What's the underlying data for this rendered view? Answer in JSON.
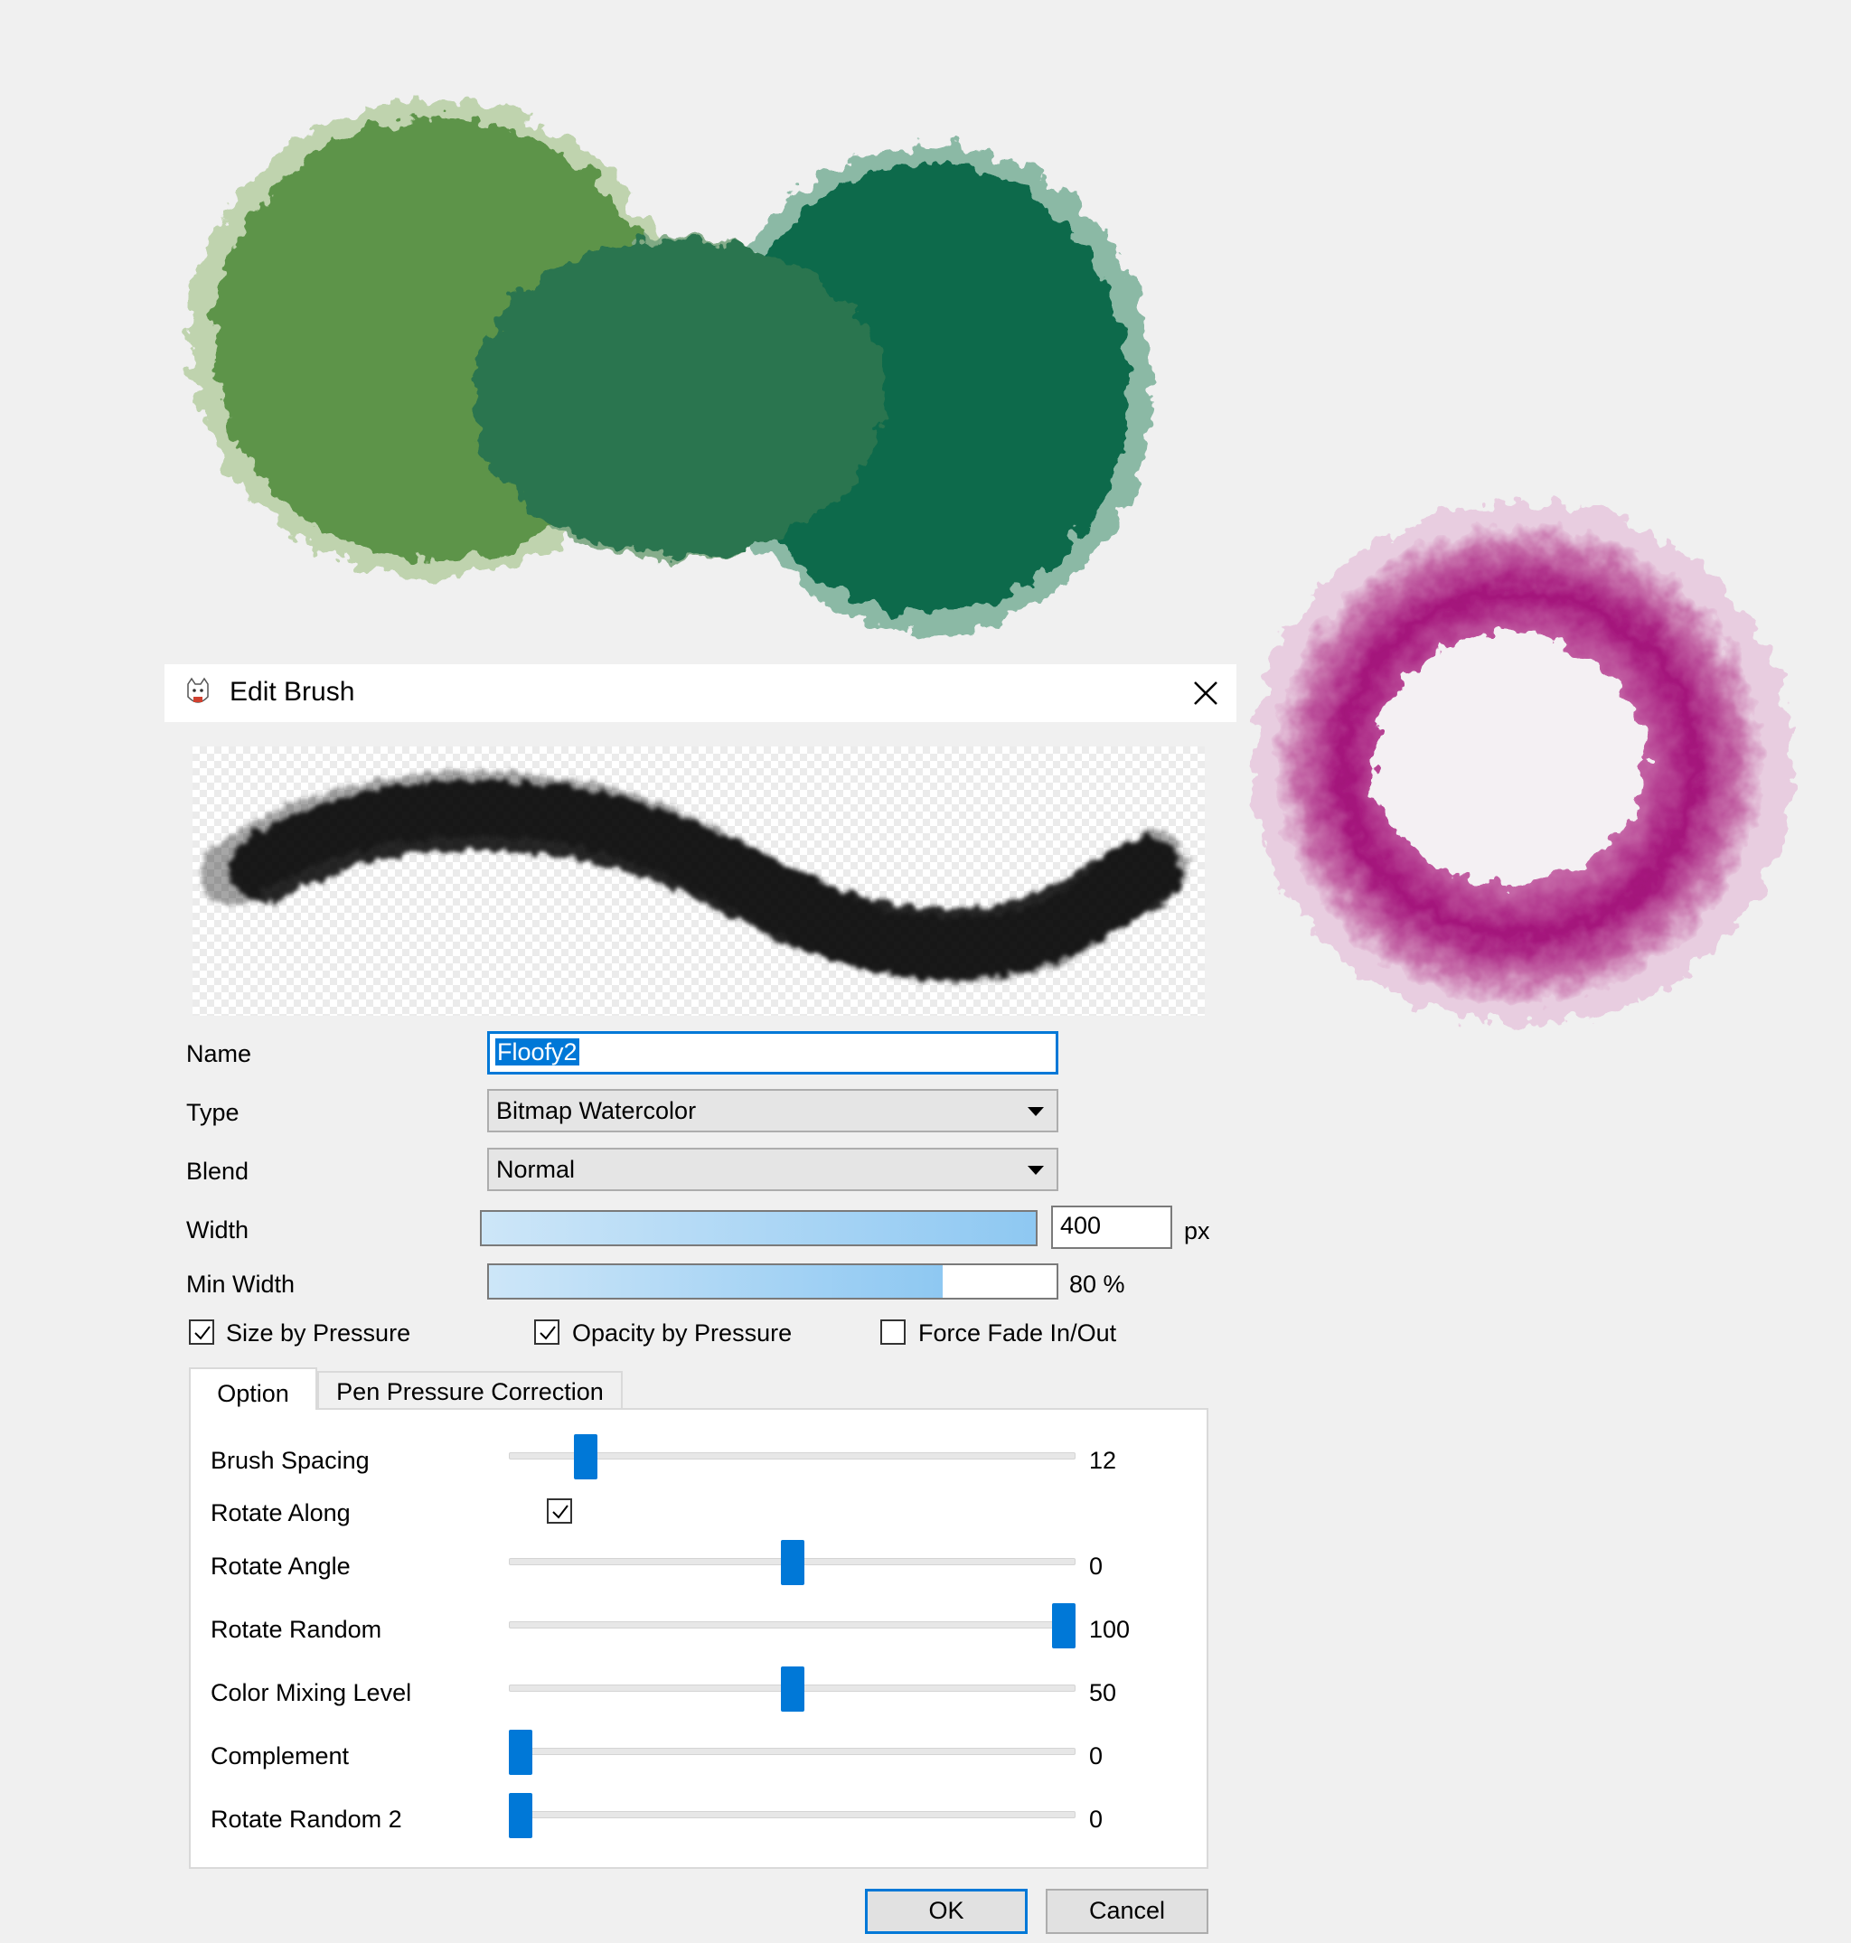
{
  "dialog": {
    "title": "Edit Brush",
    "close_icon": "close-icon",
    "app_icon": "app-icon"
  },
  "form": {
    "name_label": "Name",
    "name_value": "Floofy2",
    "type_label": "Type",
    "type_value": "Bitmap Watercolor",
    "blend_label": "Blend",
    "blend_value": "Normal",
    "width_label": "Width",
    "width_value": "400",
    "width_unit": "px",
    "width_fill": 1.0,
    "min_width_label": "Min Width",
    "min_width_value": "80 %",
    "min_width_fill": 0.8
  },
  "checkboxes": {
    "size_by_pressure": {
      "label": "Size by Pressure",
      "checked": true
    },
    "opacity_by_pressure": {
      "label": "Opacity by Pressure",
      "checked": true
    },
    "force_fade": {
      "label": "Force Fade In/Out",
      "checked": false
    }
  },
  "tabs": [
    {
      "label": "Option",
      "active": true
    },
    {
      "label": "Pen Pressure Correction",
      "active": false
    }
  ],
  "options": {
    "brush_spacing": {
      "label": "Brush Spacing",
      "value": "12",
      "position": 0.12
    },
    "rotate_along": {
      "label": "Rotate Along",
      "checked": true
    },
    "rotate_angle": {
      "label": "Rotate Angle",
      "value": "0",
      "position": 0.5
    },
    "rotate_random": {
      "label": "Rotate Random",
      "value": "100",
      "position": 1.0
    },
    "color_mixing": {
      "label": "Color Mixing Level",
      "value": "50",
      "position": 0.5
    },
    "complement": {
      "label": "Complement",
      "value": "0",
      "position": 0.0
    },
    "rotate_random_2": {
      "label": "Rotate Random 2",
      "value": "0",
      "position": 0.0
    }
  },
  "buttons": {
    "ok": "OK",
    "cancel": "Cancel"
  },
  "colors": {
    "accent": "#0078d7",
    "green_light": "#5e9448",
    "green_dark": "#0f6b4c",
    "magenta": "#a3127a"
  }
}
